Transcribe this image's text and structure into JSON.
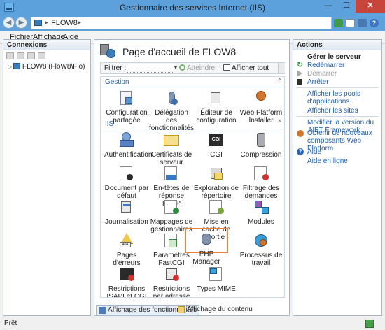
{
  "window": {
    "title": "Gestionnaire des services Internet (IIS)",
    "close_glyph": "✕",
    "min_glyph": "—",
    "max_glyph": "☐"
  },
  "address": {
    "crumb": "FLOW8",
    "sep": "▸",
    "back_glyph": "◀",
    "fwd_glyph": "▶",
    "help_glyph": "?"
  },
  "menu": [
    "Fichier",
    "Affichage",
    "Aide"
  ],
  "connections": {
    "title": "Connexions",
    "node": "FLOW8 (FloW8\\Flo)",
    "expand_glyph": "▷"
  },
  "center": {
    "title": "Page d'accueil de FLOW8",
    "filter_label": "Filtrer :",
    "filter_value": "",
    "go_label": "Atteindre",
    "show_all_label": "Afficher tout",
    "groups": [
      {
        "label": "Gestion",
        "toggle": "⌃"
      },
      {
        "label": "IIS",
        "toggle": "⌃"
      }
    ],
    "features": [
      {
        "label": "Configuration partagée",
        "icon": "shared-config-icon"
      },
      {
        "label": "Délégation des fonctionnalités",
        "icon": "feature-delegation-icon"
      },
      {
        "label": "Éditeur de configuration",
        "icon": "config-editor-icon"
      },
      {
        "label": "Web Platform Installer",
        "icon": "web-platform-installer-icon"
      },
      {
        "label": "Authentification",
        "icon": "authentication-icon"
      },
      {
        "label": "Certificats de serveur",
        "icon": "server-certificates-icon"
      },
      {
        "label": "CGI",
        "icon": "cgi-icon"
      },
      {
        "label": "Compression",
        "icon": "compression-icon"
      },
      {
        "label": "Document par défaut",
        "icon": "default-document-icon"
      },
      {
        "label": "En-têtes de réponse HTTP",
        "icon": "http-response-headers-icon"
      },
      {
        "label": "Exploration de répertoire",
        "icon": "directory-browsing-icon"
      },
      {
        "label": "Filtrage des demandes",
        "icon": "request-filtering-icon"
      },
      {
        "label": "Journalisation",
        "icon": "logging-icon"
      },
      {
        "label": "Mappages de gestionnaires",
        "icon": "handler-mappings-icon"
      },
      {
        "label": "Mise en cache de sortie",
        "icon": "output-caching-icon"
      },
      {
        "label": "Modules",
        "icon": "modules-icon"
      },
      {
        "label": "Pages d'erreurs",
        "icon": "error-pages-icon"
      },
      {
        "label": "Paramètres FastCGI",
        "icon": "fastcgi-settings-icon"
      },
      {
        "label": "PHP Manager",
        "icon": "php-manager-icon"
      },
      {
        "label": "Processus de travail",
        "icon": "worker-processes-icon"
      },
      {
        "label": "Restrictions ISAPI et CGI",
        "icon": "isapi-cgi-restrictions-icon"
      },
      {
        "label": "Restrictions par adresse IP et ...",
        "icon": "ip-restrictions-icon"
      },
      {
        "label": "Types MIME",
        "icon": "mime-types-icon"
      }
    ],
    "cgi_badge": "CGI",
    "error_badge": "404",
    "tabs": [
      "Affichage des fonctionnalités",
      "Affichage du contenu"
    ]
  },
  "actions": {
    "title": "Actions",
    "manage_server": "Gérer le serveur",
    "restart": "Redémarrer",
    "start": "Démarrer",
    "stop": "Arrêter",
    "view_pools": "Afficher les pools d'applications",
    "view_sites": "Afficher les sites",
    "change_net": "Modifier la version du .NET Framework",
    "get_components": "Obtenir de nouveaux composants Web Platform",
    "help": "Aide",
    "online_help": "Aide en ligne",
    "restart_glyph": "↻",
    "help_glyph": "?"
  },
  "status": {
    "text": "Prêt"
  }
}
